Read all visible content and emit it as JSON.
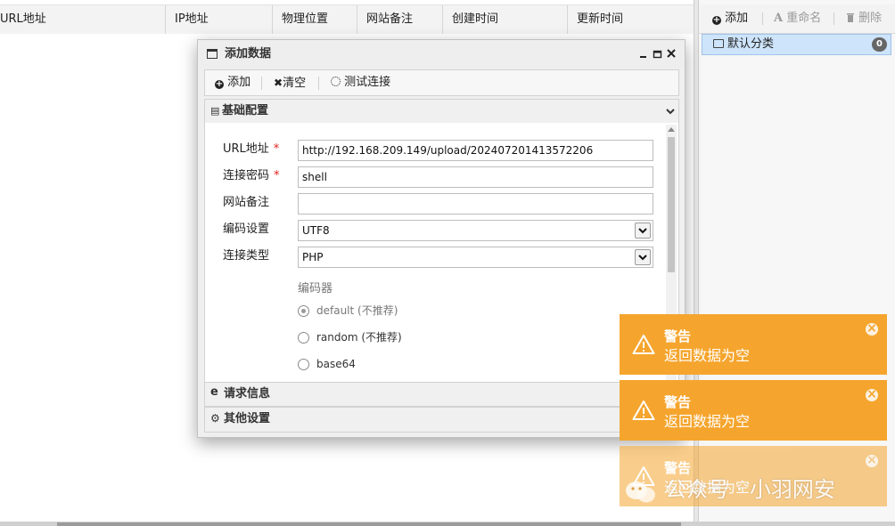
{
  "table": {
    "columns": [
      "URL地址",
      "IP地址",
      "物理位置",
      "网站备注",
      "创建时间",
      "更新时间"
    ]
  },
  "category_panel": {
    "toolbar": {
      "add_label": "添加",
      "rename_label": "重命名",
      "delete_label": "删除"
    },
    "items": [
      {
        "label": "默认分类",
        "count": "0"
      }
    ]
  },
  "dialog": {
    "title": "添加数据",
    "toolbar": {
      "add_label": "添加",
      "clear_label": "清空",
      "test_label": "测试连接"
    },
    "sections": {
      "basic": "基础配置",
      "request": "请求信息",
      "other": "其他设置"
    },
    "form": {
      "url_label": "URL地址",
      "url_value": "http://192.168.209.149/upload/202407201413572206",
      "password_label": "连接密码",
      "password_value": "shell",
      "note_label": "网站备注",
      "note_value": "",
      "encoding_label": "编码设置",
      "encoding_value": "UTF8",
      "type_label": "连接类型",
      "type_value": "PHP",
      "required_mark": "*",
      "encoder_label": "编码器",
      "encoders": [
        {
          "label": "default (不推荐)",
          "checked": true
        },
        {
          "label": "random (不推荐)",
          "checked": false
        },
        {
          "label": "base64",
          "checked": false
        }
      ]
    }
  },
  "toasts": [
    {
      "title": "警告",
      "message": "返回数据为空"
    },
    {
      "title": "警告",
      "message": "返回数据为空"
    },
    {
      "title": "警告",
      "message": "返回数据为空"
    }
  ],
  "watermark": "公众号 · 小羽网安",
  "colors": {
    "toast_bg": "#f5a52d",
    "selected_category_bg": "#cde4fb",
    "required_mark": "#e0201c"
  }
}
